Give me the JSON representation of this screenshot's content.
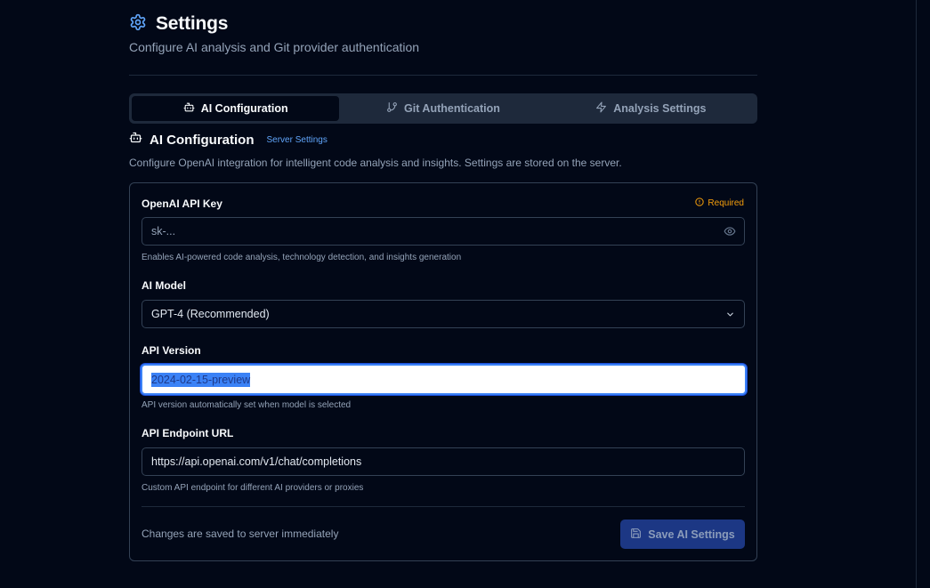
{
  "header": {
    "title": "Settings",
    "subtitle": "Configure AI analysis and Git provider authentication"
  },
  "tabs": [
    {
      "label": "AI Configuration",
      "icon": "bot-icon",
      "active": true
    },
    {
      "label": "Git Authentication",
      "icon": "git-branch-icon",
      "active": false
    },
    {
      "label": "Analysis Settings",
      "icon": "zap-icon",
      "active": false
    }
  ],
  "section": {
    "title": "AI Configuration",
    "badge": "Server Settings",
    "description": "Configure OpenAI integration for intelligent code analysis and insights. Settings are stored on the server."
  },
  "form": {
    "api_key": {
      "label": "OpenAI API Key",
      "required_label": "Required",
      "placeholder": "sk-...",
      "value": "",
      "helper": "Enables AI-powered code analysis, technology detection, and insights generation"
    },
    "model": {
      "label": "AI Model",
      "selected": "GPT-4 (Recommended)"
    },
    "api_version": {
      "label": "API Version",
      "value": "2024-02-15-preview",
      "helper": "API version automatically set when model is selected"
    },
    "endpoint": {
      "label": "API Endpoint URL",
      "value": "https://api.openai.com/v1/chat/completions",
      "helper": "Custom API endpoint for different AI providers or proxies"
    }
  },
  "footer": {
    "note": "Changes are saved to server immediately",
    "save_label": "Save AI Settings"
  },
  "colors": {
    "background": "#020817",
    "accent": "#3b82f6",
    "badge": "#60a5fa",
    "required": "#f59e0b",
    "button": "#1e3a8a"
  }
}
